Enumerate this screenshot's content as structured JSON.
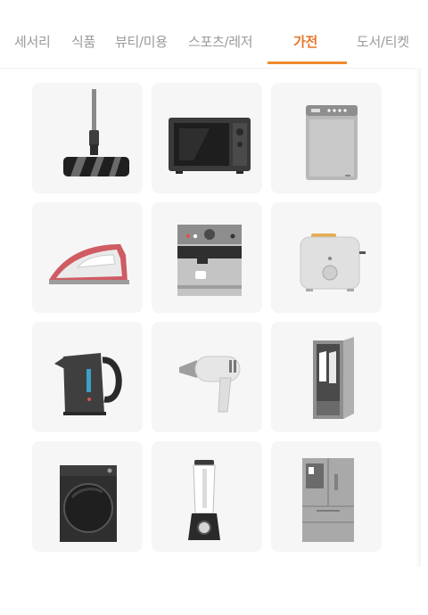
{
  "tabs": [
    {
      "label": "세서리",
      "active": false
    },
    {
      "label": "식품",
      "active": false
    },
    {
      "label": "뷰티/미용",
      "active": false
    },
    {
      "label": "스포츠/레저",
      "active": false
    },
    {
      "label": "가전",
      "active": true
    },
    {
      "label": "도서/티켓",
      "active": false
    }
  ],
  "accent_color": "#ef8a2e",
  "products": [
    {
      "icon": "vacuum-cleaner-icon"
    },
    {
      "icon": "microwave-icon"
    },
    {
      "icon": "washing-machine-icon"
    },
    {
      "icon": "iron-icon"
    },
    {
      "icon": "coffee-machine-icon"
    },
    {
      "icon": "toaster-icon"
    },
    {
      "icon": "electric-kettle-icon"
    },
    {
      "icon": "hair-dryer-icon"
    },
    {
      "icon": "clothes-steamer-icon"
    },
    {
      "icon": "drum-washer-icon"
    },
    {
      "icon": "blender-icon"
    },
    {
      "icon": "refrigerator-icon"
    }
  ]
}
